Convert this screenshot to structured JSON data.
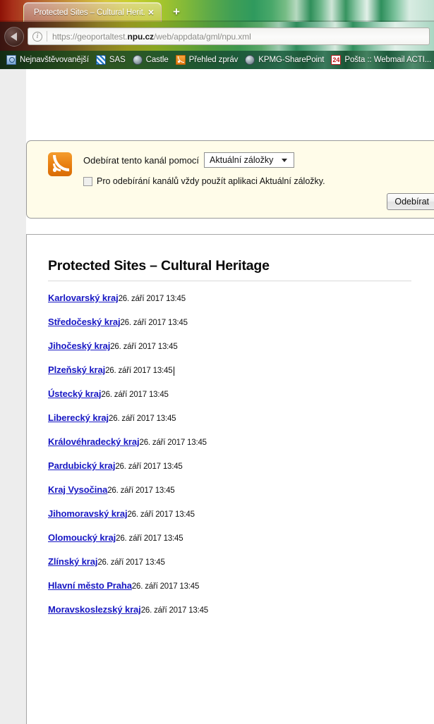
{
  "browser": {
    "tab": {
      "title": "Protected Sites – Cultural Herit...",
      "close_label": "×"
    },
    "new_tab_label": "+",
    "nav": {
      "back_label": "Back",
      "url_prefix": "https://geoportaltest.",
      "url_domain": "npu.cz",
      "url_suffix": "/web/appdata/gml/npu.xml"
    },
    "bookmarks": [
      {
        "label": "Nejnavštěvovanější",
        "icon": "bookmarks-icon"
      },
      {
        "label": "SAS",
        "icon": "sas-icon"
      },
      {
        "label": "Castle",
        "icon": "globe-icon"
      },
      {
        "label": "Přehled zpráv",
        "icon": "rss-icon"
      },
      {
        "label": "KPMG-SharePoint",
        "icon": "globe-icon"
      },
      {
        "label": "Pošta :: Webmail ACTI...",
        "icon": "twentyfour-icon"
      }
    ]
  },
  "subscribe": {
    "icon": "rss-feed-icon",
    "label": "Odebírat tento kanál pomocí",
    "reader_selected": "Aktuální záložky",
    "always_use_label": "Pro odebírání kanálů vždy použít aplikaci Aktuální záložky.",
    "always_use_checked": false,
    "button_label": "Odebírat"
  },
  "feed": {
    "title": "Protected Sites – Cultural Heritage",
    "items": [
      {
        "title": "Karlovarský kraj",
        "date": "26. září 2017 13:45",
        "caret": false
      },
      {
        "title": "Středočeský kraj",
        "date": "26. září 2017 13:45",
        "caret": false
      },
      {
        "title": "Jihočeský kraj",
        "date": "26. září 2017 13:45",
        "caret": false
      },
      {
        "title": "Plzeňský kraj",
        "date": "26. září 2017 13:45",
        "caret": true
      },
      {
        "title": "Ústecký kraj",
        "date": "26. září 2017 13:45",
        "caret": false
      },
      {
        "title": "Liberecký kraj",
        "date": "26. září 2017 13:45",
        "caret": false
      },
      {
        "title": "Královéhradecký kraj",
        "date": "26. září 2017 13:45",
        "caret": false
      },
      {
        "title": "Pardubický kraj",
        "date": "26. září 2017 13:45",
        "caret": false
      },
      {
        "title": "Kraj Vysočina",
        "date": "26. září 2017 13:45",
        "caret": false
      },
      {
        "title": "Jihomoravský kraj",
        "date": "26. září 2017 13:45",
        "caret": false
      },
      {
        "title": "Olomoucký kraj",
        "date": "26. září 2017 13:45",
        "caret": false
      },
      {
        "title": "Zlínský kraj",
        "date": "26. září 2017 13:45",
        "caret": false
      },
      {
        "title": "Hlavní město Praha",
        "date": "26. září 2017 13:45",
        "caret": false
      },
      {
        "title": "Moravskoslezský kraj",
        "date": "26. září 2017 13:45",
        "caret": false
      }
    ]
  },
  "colors": {
    "link": "#1818c4",
    "panel_bg": "#fffce9",
    "page_bg": "#ededed",
    "rss_orange": "#e87e10"
  }
}
